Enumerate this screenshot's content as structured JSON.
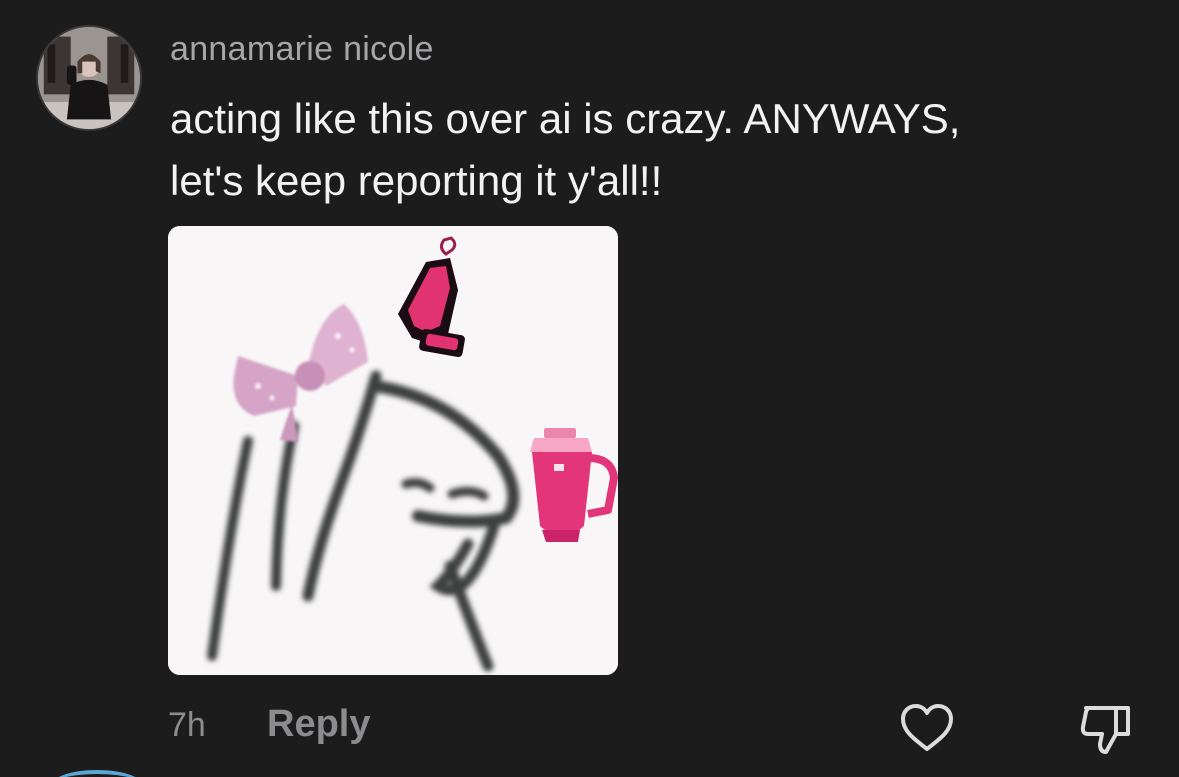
{
  "comment": {
    "username": "annamarie nicole",
    "text": "acting like this over ai is crazy. ANYWAYS,\nlet's keep reporting it y'all!!",
    "time": "7h",
    "reply_label": "Reply"
  },
  "icons": {
    "like": "heart-icon",
    "dislike": "thumbs-down-icon"
  },
  "colors": {
    "background": "#1c1c1d",
    "text": "#f2f2f3",
    "muted": "#8c8c8f",
    "accent_pink": "#e0336f"
  }
}
